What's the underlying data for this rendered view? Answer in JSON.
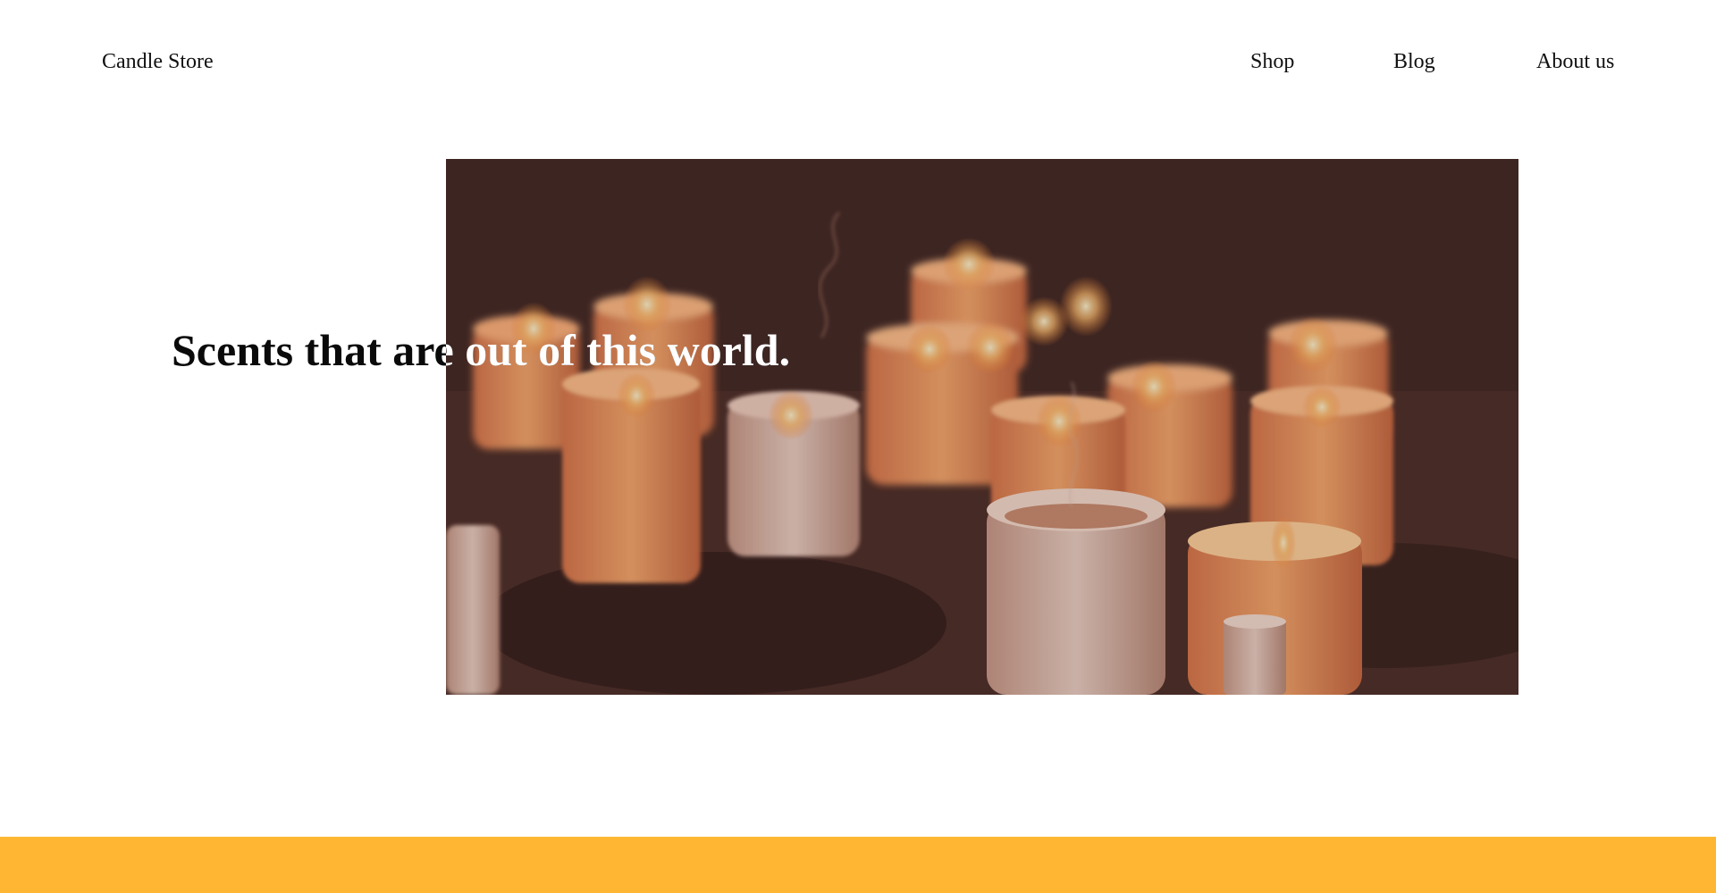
{
  "header": {
    "brand": "Candle Store",
    "nav": [
      {
        "label": "Shop"
      },
      {
        "label": "Blog"
      },
      {
        "label": "About us"
      }
    ]
  },
  "hero": {
    "headline": "Scents that are out of this world.",
    "image_subject": "lit candles"
  },
  "colors": {
    "footer_bar": "#ffb733",
    "background": "#ffffff",
    "text": "#0a0a0a"
  }
}
